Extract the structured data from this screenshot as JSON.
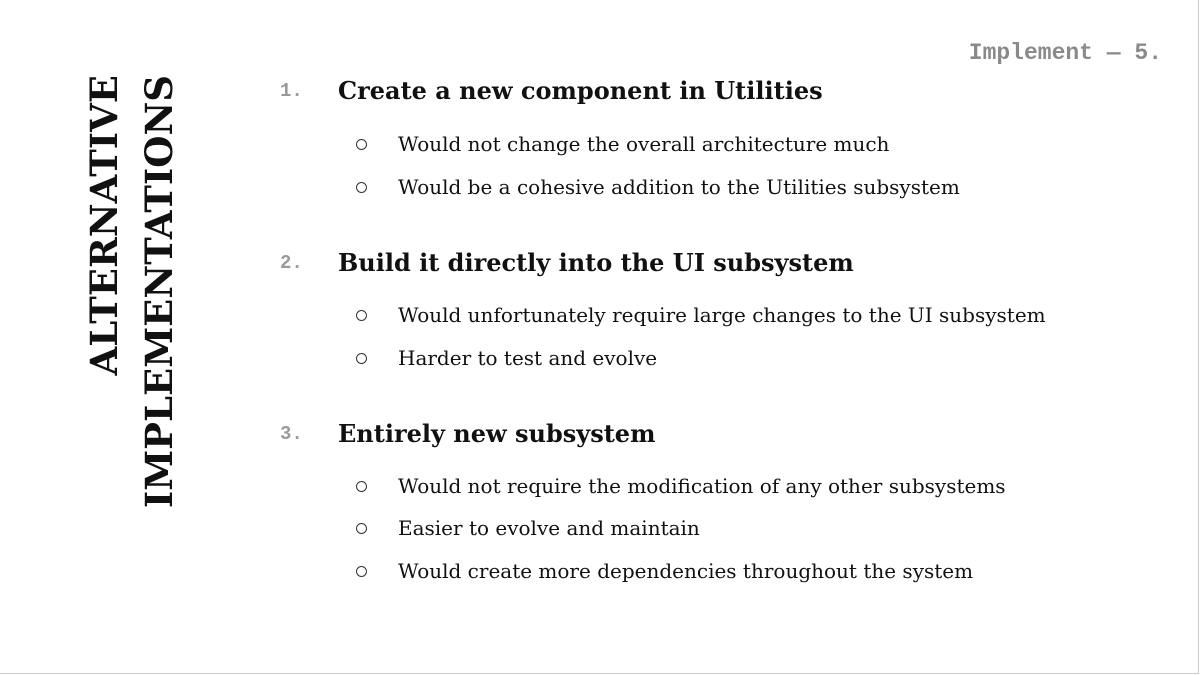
{
  "page_tag": "Implement — 5.",
  "title": {
    "line1": "ALTERNATIVE",
    "line2": "IMPLEMENTATIONS"
  },
  "items": [
    {
      "number": "1.",
      "heading": "Create a new component in Utilities",
      "points": [
        "Would not change the overall architecture much",
        "Would be a cohesive addition to the Utilities subsystem"
      ]
    },
    {
      "number": "2.",
      "heading": "Build it directly into the UI subsystem",
      "points": [
        "Would unfortunately require large changes to the UI subsystem",
        "Harder to test and evolve"
      ]
    },
    {
      "number": "3.",
      "heading": "Entirely new subsystem",
      "points": [
        "Would not require the modification of any other subsystems",
        "Easier to evolve and maintain",
        "Would create more dependencies throughout the system"
      ]
    }
  ]
}
